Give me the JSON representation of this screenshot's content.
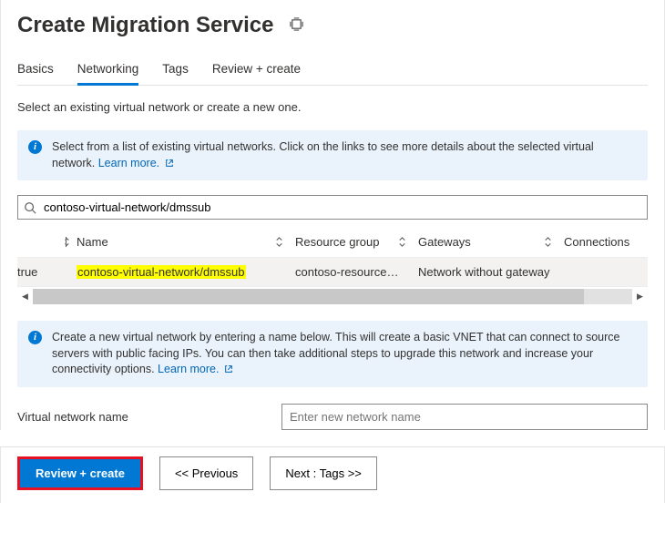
{
  "header": {
    "title": "Create Migration Service"
  },
  "tabs": [
    {
      "label": "Basics",
      "active": false
    },
    {
      "label": "Networking",
      "active": true
    },
    {
      "label": "Tags",
      "active": false
    },
    {
      "label": "Review + create",
      "active": false
    }
  ],
  "intro": "Select an existing virtual network or create a new one.",
  "info1": {
    "text": "Select from a list of existing virtual networks. Click on the links to see more details about the selected virtual network.",
    "link_label": "Learn more."
  },
  "search": {
    "value": "contoso-virtual-network/dmssub"
  },
  "grid": {
    "columns": [
      "",
      "Name",
      "Resource group",
      "Gateways",
      "Connections"
    ],
    "row": {
      "col0": "true",
      "name": "contoso-virtual-network/dmssub",
      "rg": "contoso-resource…",
      "gw": "Network without gateway",
      "conn": ""
    }
  },
  "info2": {
    "text": "Create a new virtual network by entering a name below. This will create a basic VNET that can connect to source servers with public facing IPs. You can then take additional steps to upgrade this network and increase your connectivity options.  ",
    "link_label": "Learn more."
  },
  "vnet_field": {
    "label": "Virtual network name",
    "placeholder": "Enter new network name",
    "value": ""
  },
  "footer": {
    "review": "Review + create",
    "prev": "<<  Previous",
    "next": "Next : Tags >>"
  }
}
